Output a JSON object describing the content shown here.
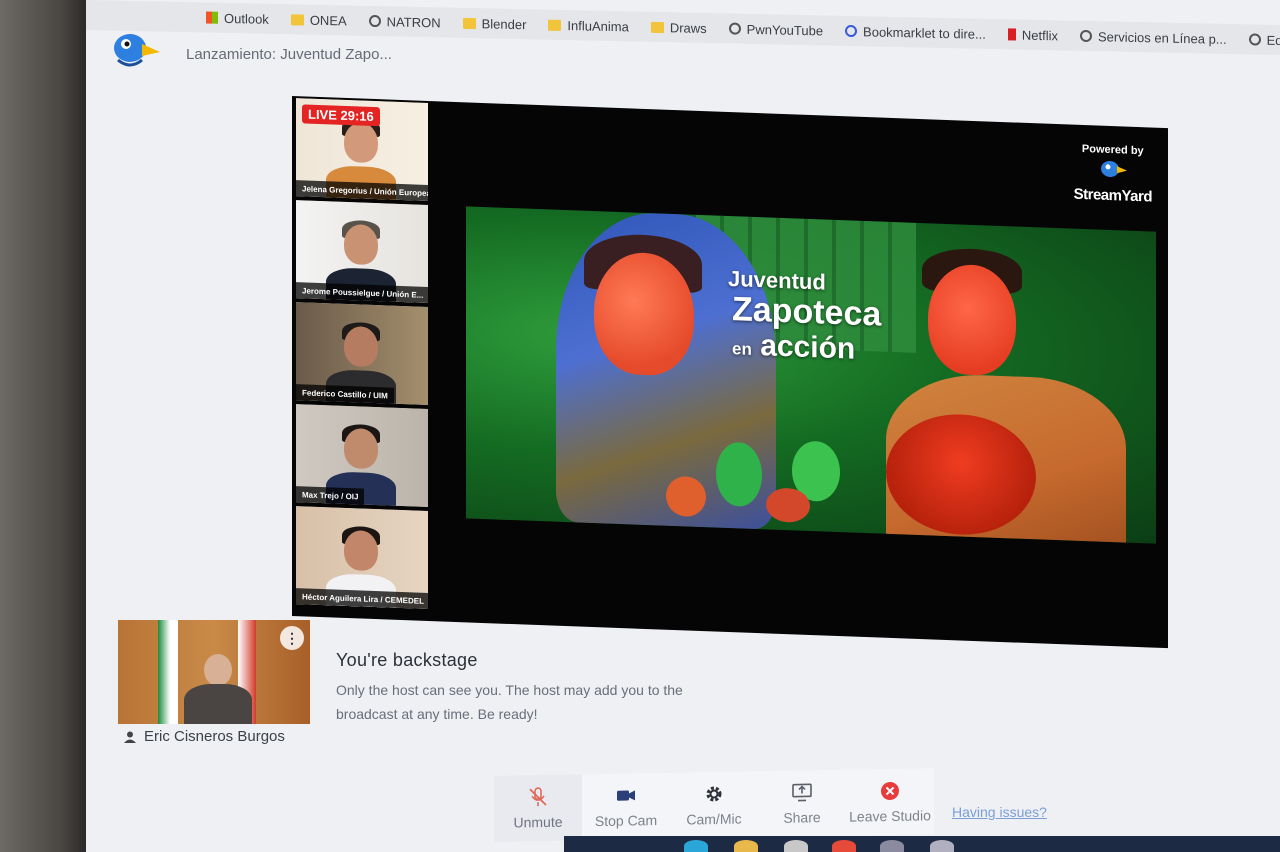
{
  "bookmarks": [
    {
      "label": "Outlook",
      "icon": "microsoft-icon"
    },
    {
      "label": "ONEA",
      "icon": "folder-icon"
    },
    {
      "label": "NATRON",
      "icon": "globe-icon"
    },
    {
      "label": "Blender",
      "icon": "folder-icon"
    },
    {
      "label": "InfluAnima",
      "icon": "folder-icon"
    },
    {
      "label": "Draws",
      "icon": "folder-icon"
    },
    {
      "label": "PwnYouTube",
      "icon": "globe-icon"
    },
    {
      "label": "Bookmarklet to dire...",
      "icon": "bookmarklet-icon"
    },
    {
      "label": "Netflix",
      "icon": "netflix-icon"
    },
    {
      "label": "Servicios en Línea p...",
      "icon": "globe-icon"
    },
    {
      "label": "Editing S",
      "icon": "globe-icon"
    }
  ],
  "header": {
    "title": "Lanzamiento: Juventud Zapo..."
  },
  "stage": {
    "live_label": "LIVE 29:16",
    "powered_by": "Powered by",
    "brand": "StreamYard",
    "participants": [
      {
        "name": "Jelena Gregorius / Unión Europea"
      },
      {
        "name": "Jerome Poussielgue / Unión E..."
      },
      {
        "name": "Federico Castillo / UIM"
      },
      {
        "name": "Max Trejo / OIJ"
      },
      {
        "name": "Héctor Aguilera Lira / CEMEDEL"
      }
    ],
    "poster": {
      "line1": "Juventud",
      "line2": "Zapoteca",
      "line3_small": "en",
      "line3": "acción"
    }
  },
  "backstage": {
    "self_name": "Eric Cisneros Burgos",
    "title": "You're backstage",
    "message": "Only the host can see you. The host may add you to the broadcast at any time. Be ready!"
  },
  "toolbar": {
    "unmute": "Unmute",
    "stop_cam": "Stop Cam",
    "cam_mic": "Cam/Mic",
    "share": "Share",
    "leave": "Leave Studio",
    "trouble": "Having issues?"
  },
  "colors": {
    "live": "#e42323",
    "leave": "#e83b3b",
    "unmute": "#e06a5a",
    "cam": "#2b3f7a"
  }
}
